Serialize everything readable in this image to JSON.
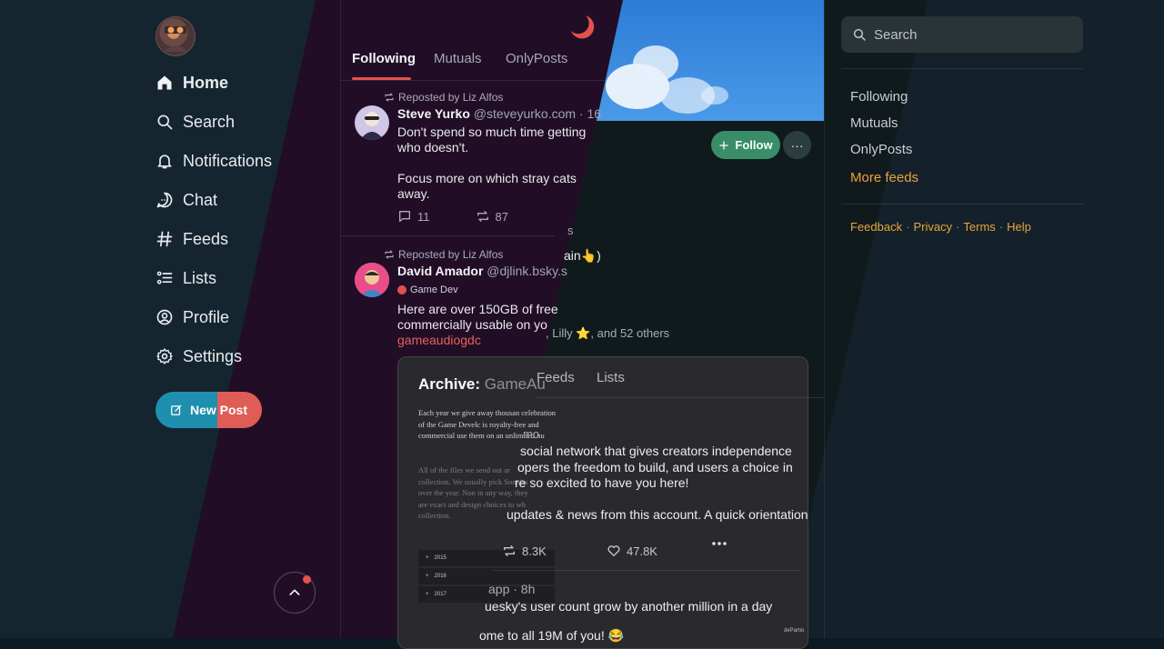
{
  "nav": {
    "items": [
      {
        "label": "Home",
        "icon": "home-icon"
      },
      {
        "label": "Search",
        "icon": "search-icon"
      },
      {
        "label": "Notifications",
        "icon": "bell-icon"
      },
      {
        "label": "Chat",
        "icon": "chat-icon"
      },
      {
        "label": "Feeds",
        "icon": "hash-icon"
      },
      {
        "label": "Lists",
        "icon": "list-icon"
      },
      {
        "label": "Profile",
        "icon": "user-circle-icon"
      },
      {
        "label": "Settings",
        "icon": "gear-icon"
      }
    ],
    "new_post_label": "New Post"
  },
  "feed_tabs": [
    "Following",
    "Mutuals",
    "OnlyPosts"
  ],
  "posts": [
    {
      "repost_label": "Reposted by Liz Alfos",
      "name": "Steve Yurko",
      "handle": "@steveyurko.com · 16",
      "text": "Don't spend so much time getting\nwho doesn't.\n\nFocus more on which stray cats \naway.",
      "replies": "11",
      "reposts": "87"
    },
    {
      "repost_label": "Reposted by Liz Alfos",
      "name": "David Amador",
      "handle": "@djlink.bsky.s",
      "badge": "Game Dev",
      "text": "Here are over 150GB of free\ncommercially usable on yo",
      "link": "gameaudiogdc"
    }
  ],
  "archive": {
    "title": "Archive:",
    "title_rest": "GameAu",
    "p1": "Each year we give away thousan celebration of the Game Develc is royalty-free and commercial use them on an unlimited nu",
    "p2": "All of the files we send out ar collection. We usually pick Sonniss over the year. Non in any way, they are exact and design choices to wh collection.",
    "rows": [
      "2015",
      "2016",
      "2017"
    ],
    "corner_text": "dePartio"
  },
  "overlay": {
    "follow_label": "Follow",
    "more_label": "···",
    "frag_s": "s",
    "frag_chain": "ain👆)",
    "followers_line": ", Lilly ⭐, and 52 others",
    "tabs": [
      "Feeds",
      "Lists"
    ],
    "frag_mo": "mo",
    "bio_lines": [
      "social network that gives creators independence",
      "opers the freedom to build, and users a choice in",
      "re so excited to have you here!",
      "updates & news from this account. A quick orientation"
    ],
    "reposts": "8.3K",
    "likes": "47.8K",
    "post2_meta": "app · 8h",
    "post2_line1": "uesky's user count grow by another million in a day",
    "post2_line2": "ome to all 19M of you! 😂"
  },
  "sidebar": {
    "search_placeholder": "Search",
    "feeds": [
      "Following",
      "Mutuals",
      "OnlyPosts"
    ],
    "more_feeds": "More feeds",
    "footer": [
      "Feedback",
      "Privacy",
      "Terms",
      "Help"
    ]
  },
  "colors": {
    "accent_red": "#e4524d",
    "accent_blue": "#1f8fb0",
    "follow_green": "#3a8d69",
    "link_orange": "#e8a33d"
  }
}
